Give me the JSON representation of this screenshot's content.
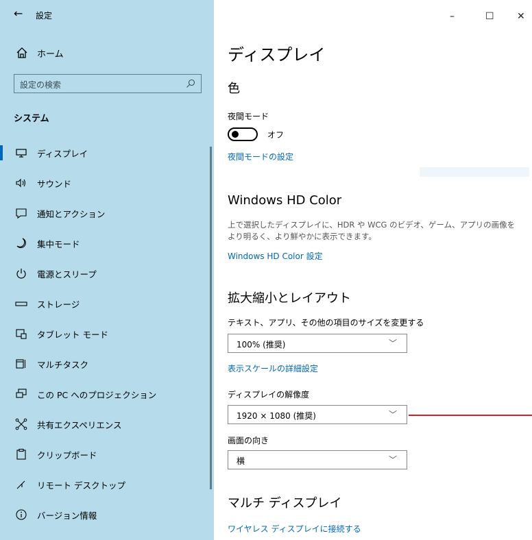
{
  "titlebar": {
    "back_icon": "arrow-left-icon",
    "title": "設定",
    "minimize": "–",
    "maximize": "☐",
    "close": "✕"
  },
  "sidebar": {
    "home_label": "ホーム",
    "search_placeholder": "設定の検索",
    "section_title": "システム",
    "items": [
      {
        "label": "ディスプレイ",
        "icon": "monitor-icon",
        "selected": true
      },
      {
        "label": "サウンド",
        "icon": "speaker-icon"
      },
      {
        "label": "通知とアクション",
        "icon": "notification-icon"
      },
      {
        "label": "集中モード",
        "icon": "moon-icon"
      },
      {
        "label": "電源とスリープ",
        "icon": "power-icon"
      },
      {
        "label": "ストレージ",
        "icon": "storage-icon"
      },
      {
        "label": "タブレット モード",
        "icon": "tablet-icon"
      },
      {
        "label": "マルチタスク",
        "icon": "multitask-icon"
      },
      {
        "label": "この PC へのプロジェクション",
        "icon": "projection-icon"
      },
      {
        "label": "共有エクスペリエンス",
        "icon": "shared-experience-icon"
      },
      {
        "label": "クリップボード",
        "icon": "clipboard-icon"
      },
      {
        "label": "リモート デスクトップ",
        "icon": "remote-desktop-icon"
      },
      {
        "label": "バージョン情報",
        "icon": "info-icon"
      }
    ]
  },
  "main": {
    "page_title": "ディスプレイ",
    "color": {
      "heading": "色",
      "night_light_label": "夜間モード",
      "night_light_state": "オフ",
      "night_light_link": "夜間モードの設定"
    },
    "hdr": {
      "heading": "Windows HD Color",
      "description": "上で選択したディスプレイに、HDR や WCG のビデオ、ゲーム、アプリの画像をより明るく、より鮮やかに表示できます。",
      "link": "Windows HD Color 設定"
    },
    "scale": {
      "heading": "拡大縮小とレイアウト",
      "size_label": "テキスト、アプリ、その他の項目のサイズを変更する",
      "size_value": "100% (推奨)",
      "advanced_link": "表示スケールの詳細設定",
      "resolution_label": "ディスプレイの解像度",
      "resolution_value": "1920 × 1080 (推奨)",
      "orientation_label": "画面の向き",
      "orientation_value": "横"
    },
    "multi": {
      "heading": "マルチ ディスプレイ",
      "wireless_link": "ワイヤレス ディスプレイに接続する"
    }
  },
  "colors": {
    "sidebar_bg": "#b6dcec",
    "accent": "#0067b8",
    "annotation_line": "#d71c2a"
  }
}
